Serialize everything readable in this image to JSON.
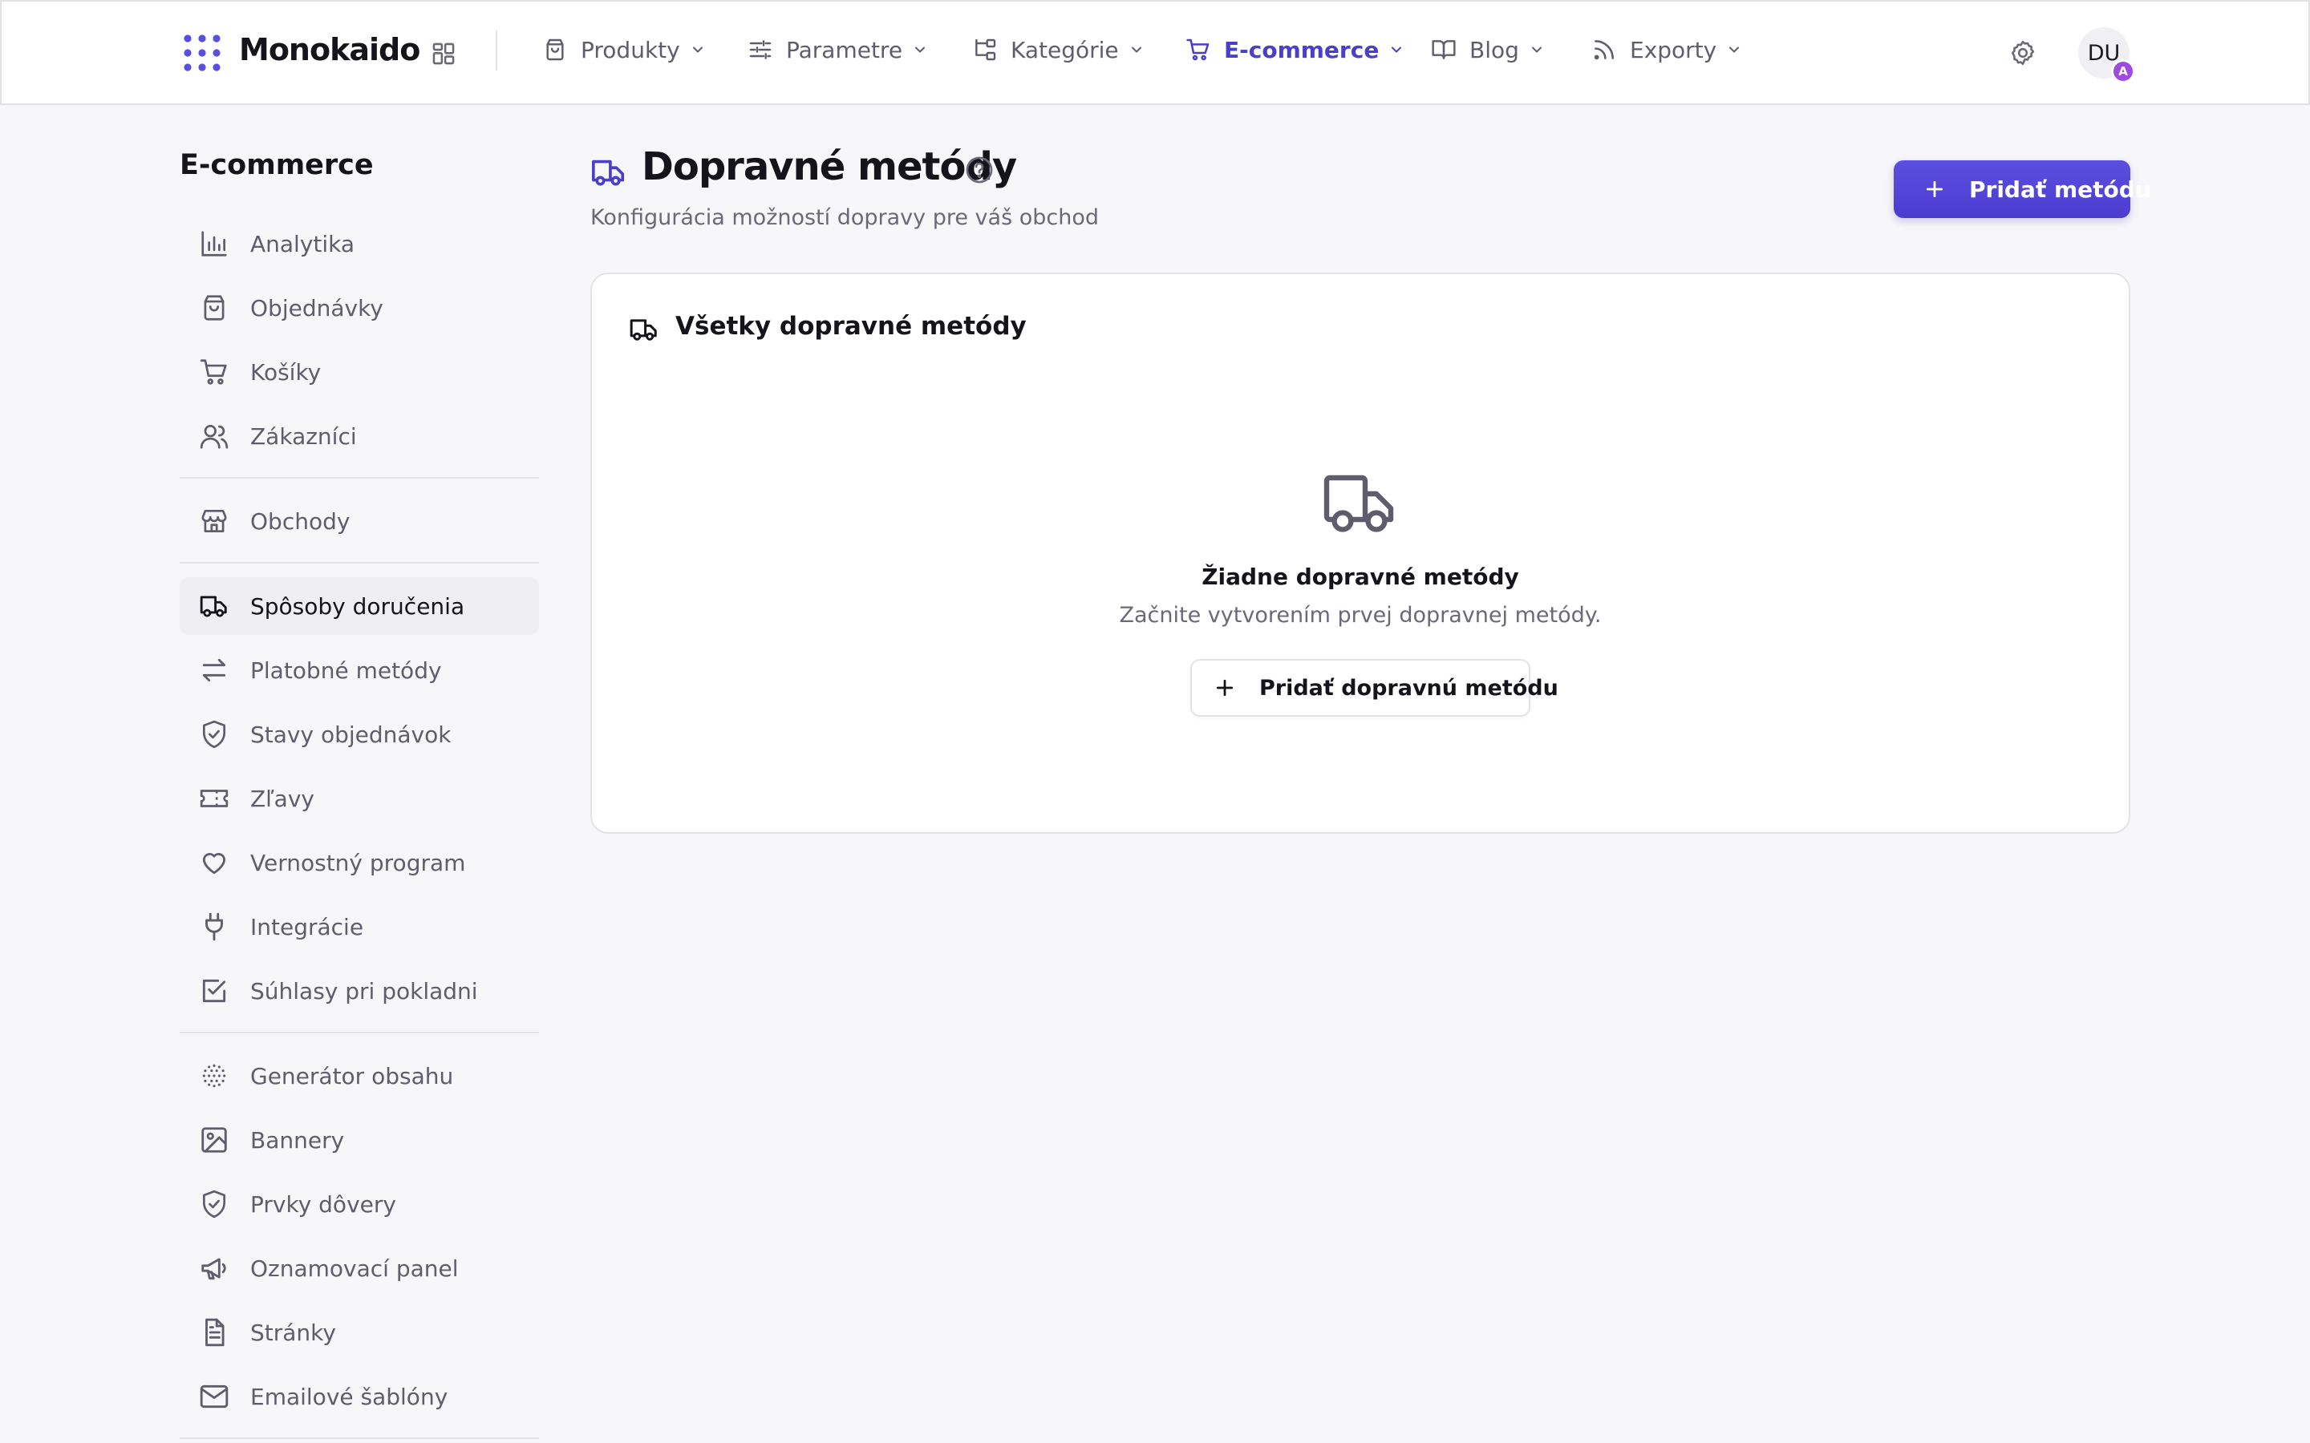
{
  "app": {
    "name": "Monokaido"
  },
  "topnav": {
    "items": [
      {
        "label": "Produkty",
        "icon": "shopping-bag-icon"
      },
      {
        "label": "Parametre",
        "icon": "sliders-icon"
      },
      {
        "label": "Kategórie",
        "icon": "category-tree-icon"
      },
      {
        "label": "E-commerce",
        "icon": "cart-icon",
        "active": true
      },
      {
        "label": "Blog",
        "icon": "book-icon"
      },
      {
        "label": "Exporty",
        "icon": "rss-icon"
      }
    ],
    "user_initials": "DU",
    "user_badge": "A"
  },
  "sidebar": {
    "title": "E-commerce",
    "items": [
      {
        "label": "Analytika",
        "icon": "bar-chart-icon"
      },
      {
        "label": "Objednávky",
        "icon": "shopping-bag-icon"
      },
      {
        "label": "Košíky",
        "icon": "cart-icon"
      },
      {
        "label": "Zákazníci",
        "icon": "users-icon"
      },
      {
        "label": "Obchody",
        "icon": "store-icon"
      },
      {
        "label": "Spôsoby doručenia",
        "icon": "truck-icon",
        "active": true
      },
      {
        "label": "Platobné metódy",
        "icon": "arrows-exchange-icon"
      },
      {
        "label": "Stavy objednávok",
        "icon": "shield-check-icon"
      },
      {
        "label": "Zľavy",
        "icon": "ticket-icon"
      },
      {
        "label": "Vernostný program",
        "icon": "heart-icon"
      },
      {
        "label": "Integrácie",
        "icon": "plug-icon"
      },
      {
        "label": "Súhlasy pri pokladni",
        "icon": "checkbox-icon"
      },
      {
        "label": "Generátor obsahu",
        "icon": "dotted-sphere-icon"
      },
      {
        "label": "Bannery",
        "icon": "image-icon"
      },
      {
        "label": "Prvky dôvery",
        "icon": "shield-check-icon"
      },
      {
        "label": "Oznamovací panel",
        "icon": "megaphone-icon"
      },
      {
        "label": "Stránky",
        "icon": "file-text-icon"
      },
      {
        "label": "Emailové šablóny",
        "icon": "mail-icon"
      }
    ]
  },
  "page": {
    "title": "Dopravné metódy",
    "subtitle": "Konfigurácia možností dopravy pre váš obchod",
    "add_button_label": "Pridať metódu"
  },
  "card": {
    "title": "Všetky dopravné metódy",
    "empty_title": "Žiadne dopravné metódy",
    "empty_description": "Začnite vytvorením prvej dopravnej metódy.",
    "empty_button_label": "Pridať dopravnú metódu"
  },
  "colors": {
    "accent": "#4b3fc8",
    "background": "#f7f6f9",
    "badge": "#a04be0"
  }
}
